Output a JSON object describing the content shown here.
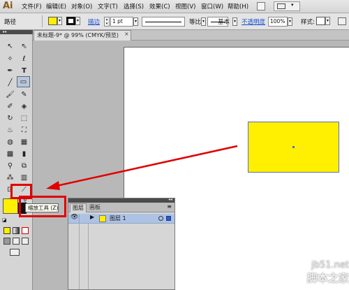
{
  "menubar": {
    "logo": "Ai",
    "items": [
      "文件(F)",
      "编辑(E)",
      "对象(O)",
      "文字(T)",
      "选择(S)",
      "效果(C)",
      "视图(V)",
      "窗口(W)",
      "帮助(H)"
    ]
  },
  "control_bar": {
    "object_label": "路径",
    "fill_color": "#ffef00",
    "stroke_link": "描边",
    "stroke_weight": "1 pt",
    "profile_label": "等比",
    "brush_label": "基本",
    "opacity_link": "不透明度",
    "opacity_value": "100%",
    "style_label": "样式:"
  },
  "document": {
    "tab_title": "未标题-9* @ 99% (CMYK/预览)",
    "tab_close": "×",
    "rect_fill": "#ffef00"
  },
  "toolbox": {
    "tools": [
      "selection-icon",
      "direct-selection-icon",
      "magic-wand-icon",
      "lasso-icon",
      "pen-icon",
      "type-icon",
      "line-icon",
      "rectangle-icon",
      "paintbrush-icon",
      "pencil-icon",
      "blob-brush-icon",
      "eraser-icon",
      "rotate-icon",
      "scale-icon",
      "warp-icon",
      "free-transform-icon",
      "shape-builder-icon",
      "perspective-icon",
      "mesh-icon",
      "gradient-icon",
      "eyedropper-icon",
      "blend-icon",
      "symbol-sprayer-icon",
      "column-graph-icon",
      "artboard-icon",
      "slice-icon",
      "hand-icon",
      "zoom-icon"
    ],
    "fill_swatch": "#ffef00",
    "tooltip": "缩放工具 (Z)"
  },
  "layers_panel": {
    "tab_layers": "图层",
    "tab_artboards": "画板",
    "layer_name": "图层 1"
  },
  "watermark": {
    "line1": "jb51.net",
    "line2": "脚本之家"
  },
  "annotation_color": "#e00000"
}
